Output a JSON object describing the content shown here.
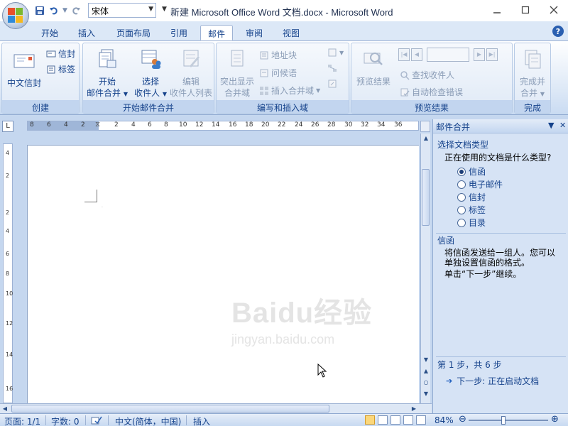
{
  "window": {
    "title": "新建 Microsoft Office Word 文档.docx - Microsoft Word",
    "font_name": "宋体",
    "minimize_icon": "minimize-icon",
    "maximize_icon": "maximize-icon",
    "close_icon": "close-icon"
  },
  "tabs": [
    {
      "label": "开始"
    },
    {
      "label": "插入"
    },
    {
      "label": "页面布局"
    },
    {
      "label": "引用"
    },
    {
      "label": "邮件",
      "active": true
    },
    {
      "label": "审阅"
    },
    {
      "label": "视图"
    }
  ],
  "ribbon": {
    "create": {
      "label": "创建",
      "chinese_envelope": "中文信封",
      "envelope": "信封",
      "labels": "标签"
    },
    "start_merge": {
      "label": "开始邮件合并",
      "start_line1": "开始",
      "start_line2": "邮件合并",
      "select_line1": "选择",
      "select_line2": "收件人",
      "edit_line1": "编辑",
      "edit_line2": "收件人列表"
    },
    "write_insert": {
      "label": "编写和插入域",
      "highlight_line1": "突出显示",
      "highlight_line2": "合并域",
      "address_block": "地址块",
      "greeting_line": "问候语",
      "insert_merge_field": "插入合并域"
    },
    "preview": {
      "label": "预览结果",
      "preview_results": "预览结果",
      "find_recipient": "查找收件人",
      "auto_check_errors": "自动检查错误"
    },
    "finish": {
      "label": "完成",
      "finish_line1": "完成并",
      "finish_line2": "合并"
    }
  },
  "ruler": {
    "h_numbers": [
      "8",
      "6",
      "4",
      "2",
      "2",
      "4",
      "6",
      "8",
      "10",
      "12",
      "14",
      "16",
      "18",
      "20",
      "22",
      "24",
      "26",
      "28",
      "30",
      "32",
      "34",
      "36"
    ],
    "v_numbers": [
      "4",
      "2",
      "2",
      "4",
      "6",
      "8",
      "10",
      "12",
      "14",
      "16"
    ]
  },
  "pane": {
    "title": "邮件合并",
    "section1_title": "选择文档类型",
    "question": "正在使用的文档是什么类型?",
    "options": [
      "信函",
      "电子邮件",
      "信封",
      "标签",
      "目录"
    ],
    "selected_index": 0,
    "section2_title": "信函",
    "desc_line1": "将信函发送给一组人。您可以",
    "desc_line2": "单独设置信函的格式。",
    "hint": "单击“下一步”继续。",
    "step": "第 1 步，共 6 步",
    "next": "下一步: 正在启动文档"
  },
  "statusbar": {
    "page": "页面: 1/1",
    "words": "字数: 0",
    "language": "中文(简体，中国)",
    "insert_mode": "插入",
    "zoom": "84%",
    "zoom_level": 0.5
  },
  "watermark": {
    "brand": "Baidu经验",
    "url": "jingyan.baidu.com"
  },
  "colors": {
    "accent": "#15428b",
    "ribbon_bg": "#dbe7f6",
    "active_view": "#fbd77b"
  }
}
